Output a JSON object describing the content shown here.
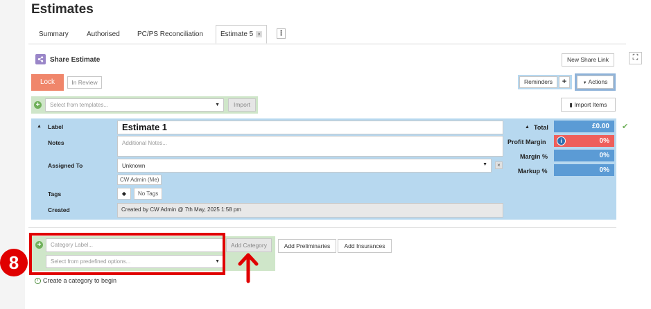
{
  "page": {
    "title": "Estimates"
  },
  "tabs": [
    {
      "label": "Summary"
    },
    {
      "label": "Authorised"
    },
    {
      "label": "PC/PS Reconciliation"
    },
    {
      "label": "Estimate 5",
      "close": "×"
    }
  ],
  "tabs_more": "⋮",
  "share": {
    "label": "Share Estimate",
    "icon": "share-icon",
    "new_link": "New Share Link"
  },
  "toolbar": {
    "lock": "Lock",
    "in_review": "In Review",
    "reminders": "Reminders",
    "plus": "+",
    "actions": "Actions",
    "import_items": "Import Items"
  },
  "templates": {
    "placeholder": "Select from templates...",
    "import": "Import"
  },
  "estimate": {
    "label_caption": "Label",
    "label_value": "Estimate 1",
    "notes_caption": "Notes",
    "notes_placeholder": "Additional Notes...",
    "assigned_caption": "Assigned To",
    "assigned_value": "Unknown",
    "assigned_chip": "CW Admin (Me)",
    "tags_caption": "Tags",
    "tags_value": "No Tags",
    "created_caption": "Created",
    "created_value": "Created by CW Admin @ 7th May, 2025 1:58 pm"
  },
  "totals": {
    "total_label": "Total",
    "total_value": "£0.00",
    "profit_margin_label": "Profit Margin",
    "profit_margin_value": "0%",
    "margin_label": "Margin %",
    "margin_value": "0%",
    "markup_label": "Markup %",
    "markup_value": "0%"
  },
  "category": {
    "label_placeholder": "Category Label...",
    "options_placeholder": "Select from predefined options...",
    "add_category": "Add Category",
    "add_preliminaries": "Add Preliminaries",
    "add_insurances": "Add Insurances",
    "hint": "Create a category to begin"
  },
  "annotation": {
    "step": "8"
  },
  "colors": {
    "lock": "#f0866b",
    "panel": "#b7d8ef",
    "value": "#5b9bd5",
    "profit": "#ee5f5b",
    "highlight": "#e00000",
    "green": "#cfe6c9"
  }
}
